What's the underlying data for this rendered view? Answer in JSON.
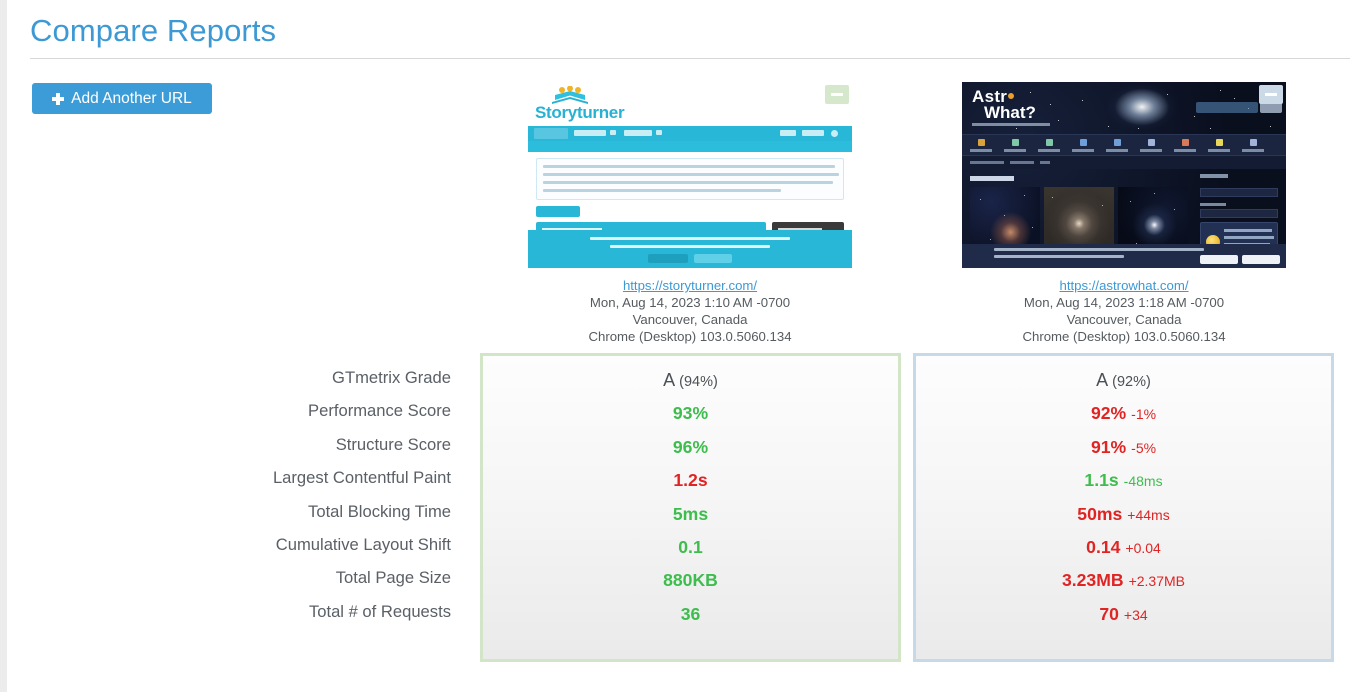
{
  "header": {
    "title": "Compare Reports"
  },
  "toolbar": {
    "add_url_label": "Add Another URL",
    "add_url_icon": "plus-icon",
    "accent_color": "#3c9cd8"
  },
  "reports": [
    {
      "url": "https://storyturner.com/",
      "timestamp": "Mon, Aug 14, 2023 1:10 AM -0700",
      "location": "Vancouver, Canada",
      "browser": "Chrome (Desktop) 103.0.5060.134",
      "remove_icon": "minus-icon",
      "border_color": "#d2e5c6",
      "thumbnail_site_name": "Storyturner"
    },
    {
      "url": "https://astrowhat.com/",
      "timestamp": "Mon, Aug 14, 2023 1:18 AM -0700",
      "location": "Vancouver, Canada",
      "browser": "Chrome (Desktop) 103.0.5060.134",
      "remove_icon": "minus-icon",
      "border_color": "#c6d9e8",
      "thumbnail_site_name": "Astro What?"
    }
  ],
  "metrics": {
    "labels": [
      "GTmetrix Grade",
      "Performance Score",
      "Structure Score",
      "Largest Contentful Paint",
      "Total Blocking Time",
      "Cumulative Layout Shift",
      "Total Page Size",
      "Total # of Requests"
    ],
    "colors": {
      "good": "#3ebd4e",
      "bad": "#e02424",
      "neutral": "#4b5156"
    },
    "column_1": [
      {
        "value": "A",
        "suffix": "(94%)",
        "tone": "neutral",
        "delta": "",
        "delta_tone": ""
      },
      {
        "value": "93%",
        "suffix": "",
        "tone": "good",
        "delta": "",
        "delta_tone": ""
      },
      {
        "value": "96%",
        "suffix": "",
        "tone": "good",
        "delta": "",
        "delta_tone": ""
      },
      {
        "value": "1.2s",
        "suffix": "",
        "tone": "bad",
        "delta": "",
        "delta_tone": ""
      },
      {
        "value": "5ms",
        "suffix": "",
        "tone": "good",
        "delta": "",
        "delta_tone": ""
      },
      {
        "value": "0.1",
        "suffix": "",
        "tone": "good",
        "delta": "",
        "delta_tone": ""
      },
      {
        "value": "880KB",
        "suffix": "",
        "tone": "good",
        "delta": "",
        "delta_tone": ""
      },
      {
        "value": "36",
        "suffix": "",
        "tone": "good",
        "delta": "",
        "delta_tone": ""
      }
    ],
    "column_2": [
      {
        "value": "A",
        "suffix": "(92%)",
        "tone": "neutral",
        "delta": "",
        "delta_tone": ""
      },
      {
        "value": "92%",
        "suffix": "",
        "tone": "bad",
        "delta": "-1%",
        "delta_tone": "bad"
      },
      {
        "value": "91%",
        "suffix": "",
        "tone": "bad",
        "delta": "-5%",
        "delta_tone": "bad"
      },
      {
        "value": "1.1s",
        "suffix": "",
        "tone": "good",
        "delta": "-48ms",
        "delta_tone": "good"
      },
      {
        "value": "50ms",
        "suffix": "",
        "tone": "bad",
        "delta": "+44ms",
        "delta_tone": "bad"
      },
      {
        "value": "0.14",
        "suffix": "",
        "tone": "bad",
        "delta": "+0.04",
        "delta_tone": "bad"
      },
      {
        "value": "3.23MB",
        "suffix": "",
        "tone": "bad",
        "delta": "+2.37MB",
        "delta_tone": "bad"
      },
      {
        "value": "70",
        "suffix": "",
        "tone": "bad",
        "delta": "+34",
        "delta_tone": "bad"
      }
    ]
  }
}
